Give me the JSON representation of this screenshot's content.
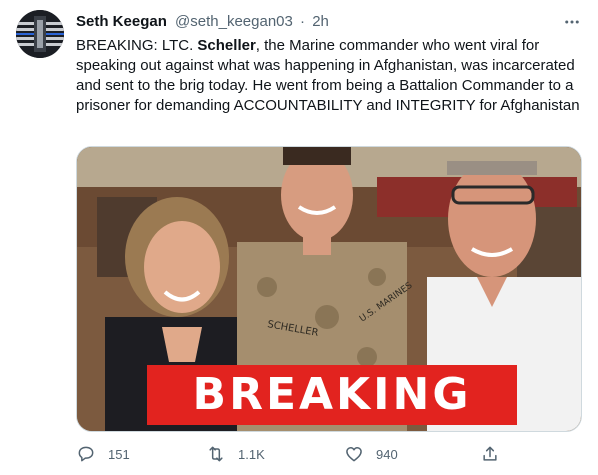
{
  "tweet": {
    "display_name": "Seth Keegan",
    "handle": "@seth_keegan03",
    "separator": "·",
    "time": "2h",
    "text": {
      "p1": "BREAKING: LTC. ",
      "bold": "Scheller",
      "p2": ", the Marine commander who went viral for speaking out against what was happening in Afghanistan, was incarcerated and sent to the brig today. He went from being a Battalion Commander to a prisoner for demanding ACCOUNTABILITY and INTEGRITY for Afghanistan"
    },
    "media": {
      "banner_text": "BREAKING",
      "uniform_tape": "SCHELLER",
      "uniform_branch": "U.S. MARINES",
      "banner_color": "#e2231f"
    }
  },
  "actions": {
    "reply_count": "151",
    "retweet_count": "1.1K",
    "like_count": "940"
  },
  "colors": {
    "text_primary": "#0f1419",
    "text_secondary": "#536471",
    "border": "#cfd9de"
  },
  "icons": [
    "avatar-flag",
    "more-icon",
    "reply-icon",
    "retweet-icon",
    "like-icon",
    "share-icon"
  ]
}
